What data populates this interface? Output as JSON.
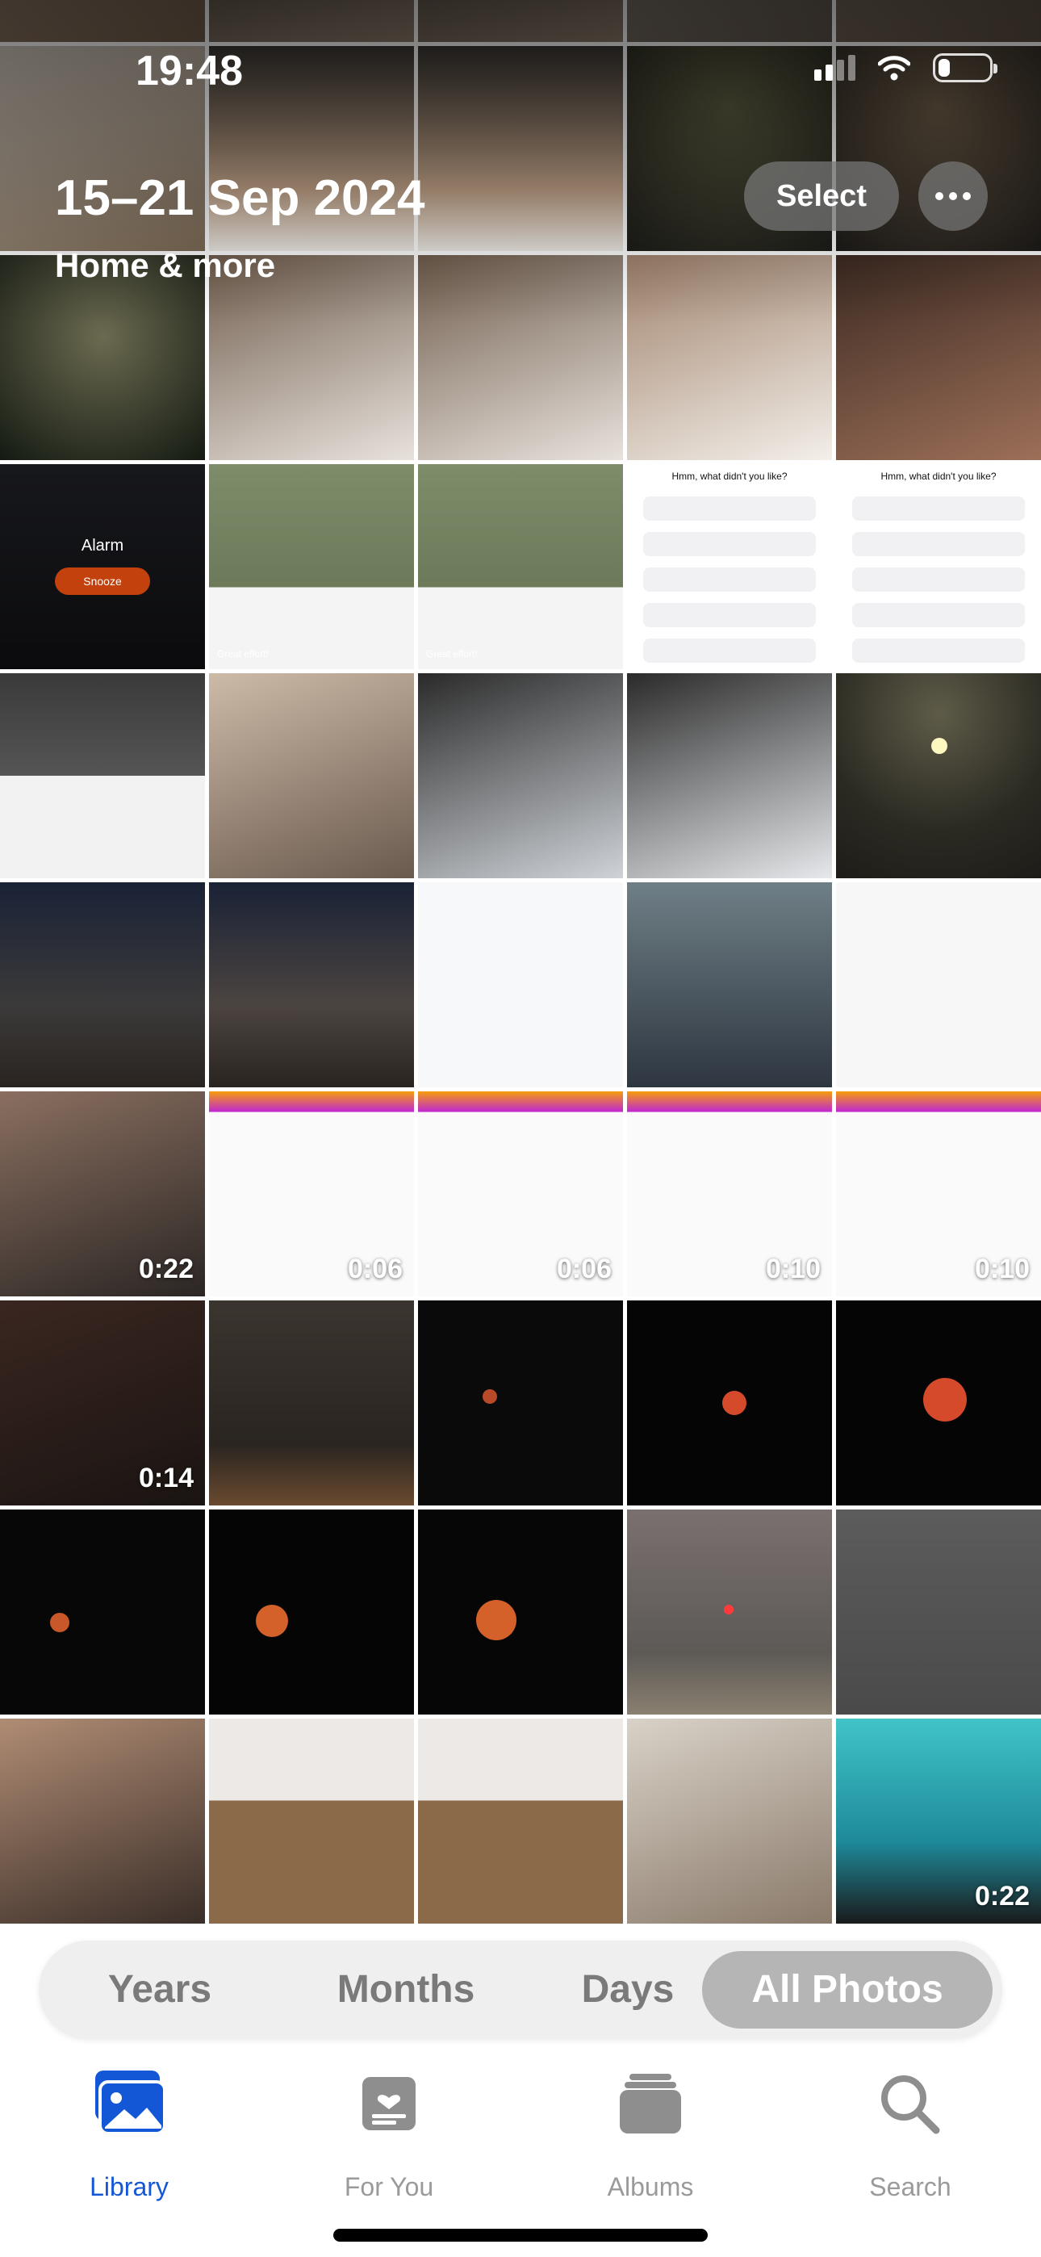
{
  "status_bar": {
    "time": "19:48"
  },
  "header": {
    "date_range": "15–21 Sep 2024",
    "location": "Home & more",
    "select_label": "Select"
  },
  "segment_control": {
    "items": [
      "Years",
      "Months",
      "Days",
      "All Photos"
    ],
    "selected": "All Photos"
  },
  "tab_bar": {
    "items": [
      {
        "label": "Library",
        "icon": "photo-library-icon",
        "active": true
      },
      {
        "label": "For You",
        "icon": "for-you-icon",
        "active": false
      },
      {
        "label": "Albums",
        "icon": "albums-icon",
        "active": false
      },
      {
        "label": "Search",
        "icon": "magnifying-glass-icon",
        "active": false
      }
    ]
  },
  "colors": {
    "accent": "#1457d6",
    "segment_bg": "#efefef",
    "segment_selected": "#b5b5b5"
  },
  "photos": {
    "tiles": [
      {
        "type": "photo"
      },
      {
        "type": "photo"
      },
      {
        "type": "photo"
      },
      {
        "type": "photo"
      },
      {
        "type": "photo"
      },
      {
        "type": "photo"
      },
      {
        "type": "photo"
      },
      {
        "type": "photo"
      },
      {
        "type": "photo"
      },
      {
        "type": "photo"
      },
      {
        "type": "photo"
      },
      {
        "type": "photo"
      },
      {
        "type": "photo"
      },
      {
        "type": "photo"
      },
      {
        "type": "photo"
      },
      {
        "type": "screenshot",
        "alarm_label": "Alarm",
        "snooze_label": "Snooze"
      },
      {
        "type": "screenshot",
        "caption": "Great effort!"
      },
      {
        "type": "screenshot",
        "caption": "Great effort!"
      },
      {
        "type": "screenshot",
        "title": "Hmm, what didn't you like?"
      },
      {
        "type": "screenshot",
        "title": "Hmm, what didn't you like?"
      },
      {
        "type": "screenshot"
      },
      {
        "type": "photo"
      },
      {
        "type": "screenshot"
      },
      {
        "type": "screenshot"
      },
      {
        "type": "photo"
      },
      {
        "type": "photo"
      },
      {
        "type": "photo"
      },
      {
        "type": "screenshot"
      },
      {
        "type": "screenshot"
      },
      {
        "type": "screenshot"
      },
      {
        "type": "video",
        "duration": "0:22"
      },
      {
        "type": "video",
        "duration": "0:06"
      },
      {
        "type": "video",
        "duration": "0:06"
      },
      {
        "type": "video",
        "duration": "0:10"
      },
      {
        "type": "video",
        "duration": "0:10"
      },
      {
        "type": "video",
        "duration": "0:14"
      },
      {
        "type": "photo"
      },
      {
        "type": "photo"
      },
      {
        "type": "photo"
      },
      {
        "type": "photo"
      },
      {
        "type": "photo"
      },
      {
        "type": "photo"
      },
      {
        "type": "photo"
      },
      {
        "type": "photo"
      },
      {
        "type": "photo"
      },
      {
        "type": "photo"
      },
      {
        "type": "photo"
      },
      {
        "type": "photo"
      },
      {
        "type": "photo"
      },
      {
        "type": "video",
        "duration": "0:22"
      }
    ]
  }
}
